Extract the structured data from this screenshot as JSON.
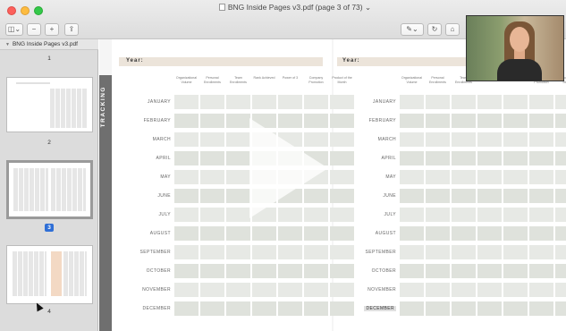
{
  "window": {
    "title": "BNG Inside Pages v3.pdf (page 3 of 73)",
    "title_suffix": "⌄"
  },
  "toolbar": {
    "sidebar_glyph": "◫⌄",
    "zoom_out_glyph": "−",
    "zoom_in_glyph": "+",
    "share_glyph": "⇪",
    "markup_glyph": "✎⌄",
    "rotate_glyph": "↻",
    "toolbox_glyph": "⌂"
  },
  "sidebar": {
    "filename": "BNG Inside Pages v3.pdf",
    "pages": [
      "1",
      "2",
      "3",
      "4"
    ],
    "selected_page": "3"
  },
  "document": {
    "tracking_label": "TRACKING",
    "year_label": "Year:",
    "column_headers": [
      "Organizational Volume",
      "Personal Enrollments",
      "Team Enrollments",
      "Rank Achieved",
      "Power of 3",
      "Company Promotion",
      "Product of the Month"
    ],
    "months": [
      "JANUARY",
      "FEBRUARY",
      "MARCH",
      "APRIL",
      "MAY",
      "JUNE",
      "JULY",
      "AUGUST",
      "SEPTEMBER",
      "OCTOBER",
      "NOVEMBER",
      "DECEMBER"
    ],
    "highlighted_month": "DECEMBER"
  },
  "colors": {
    "accent": "#2f6fd6",
    "tracking_bar": "#6f6f6f",
    "year_band": "#ece4da",
    "cell": "#e7e9e5"
  }
}
